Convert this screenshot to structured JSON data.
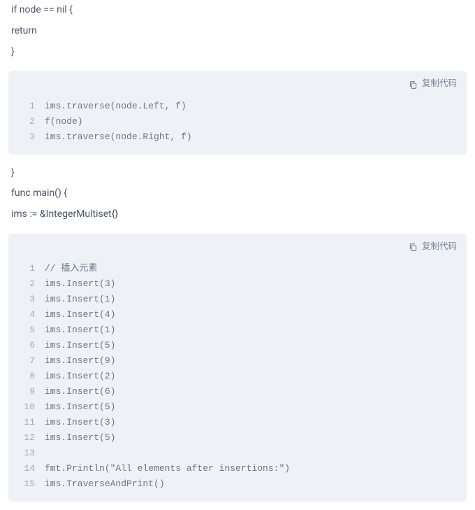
{
  "plain1": {
    "lines": [
      "if node == nil {",
      "return",
      "}"
    ]
  },
  "codeBlock1": {
    "copyLabel": "复制代码",
    "lines": [
      "ims.traverse(node.Left, f)",
      "f(node)",
      "ims.traverse(node.Right, f)"
    ]
  },
  "plain2": {
    "lines": [
      "}",
      "func main() {",
      "ims := &IntegerMultiset{}"
    ]
  },
  "codeBlock2": {
    "copyLabel": "复制代码",
    "lines": [
      "// 插入元素",
      "ims.Insert(3)",
      "ims.Insert(1)",
      "ims.Insert(4)",
      "ims.Insert(1)",
      "ims.Insert(5)",
      "ims.Insert(9)",
      "ims.Insert(2)",
      "ims.Insert(6)",
      "ims.Insert(5)",
      "ims.Insert(3)",
      "ims.Insert(5)",
      "",
      "fmt.Println(\"All elements after insertions:\")",
      "ims.TraverseAndPrint()"
    ]
  }
}
